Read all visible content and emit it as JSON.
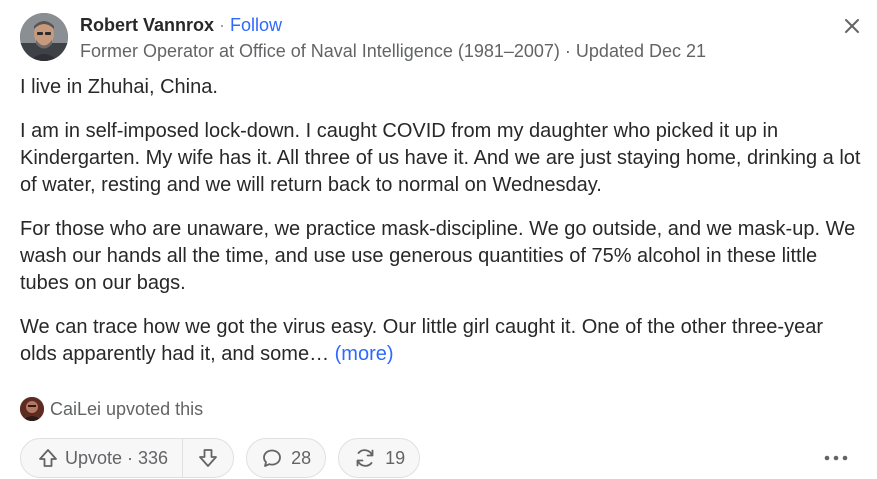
{
  "post": {
    "author": {
      "name": "Robert Vannrox",
      "separator": " · ",
      "follow_label": "Follow",
      "credential": "Former Operator at Office of Naval Intelligence (1981–2007)",
      "updated": " · Updated Dec 21"
    },
    "paragraphs": [
      "I live in Zhuhai, China.",
      "I am in self-imposed lock-down. I caught COVID from my daughter who picked it up in Kindergarten. My wife has it. All three of us have it. And we are just staying home, drinking a lot of water, resting and we will return back to normal on Wednesday.",
      "For those who are unaware, we practice mask-discipline. We go outside, and we mask-up. We wash our hands all the time, and use use generous quantities of 75% alcohol in these little tubes on our bags.",
      "We can trace how we got the virus easy. Our little girl caught it. One of the other three-year olds apparently had it, and some… "
    ],
    "more_label": "(more)",
    "upvoted_by": "CaiLei upvoted this",
    "actions": {
      "upvote_label": "Upvote · 336",
      "comments_count": "28",
      "shares_count": "19"
    }
  },
  "icons": {
    "close": "close-icon",
    "upvote": "upvote-arrow-icon",
    "downvote": "downvote-arrow-icon",
    "comment": "comment-bubble-icon",
    "share": "reshare-icon",
    "overflow": "more-dots-icon"
  },
  "colors": {
    "text": "#282829",
    "secondary": "#636466",
    "link": "#2e69ff",
    "border": "#dee0e1",
    "button_bg": "#f7f7f8"
  }
}
